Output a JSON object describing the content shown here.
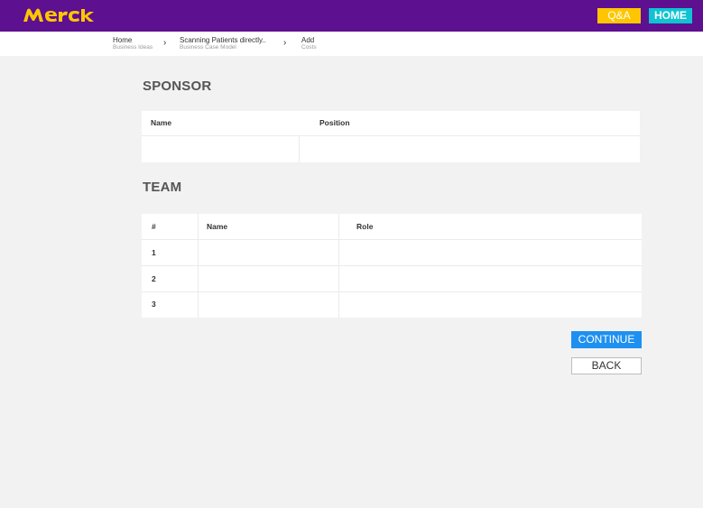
{
  "header": {
    "logo_text": "MERCK",
    "qa_label": "Q&A",
    "home_label": "HOME",
    "colors": {
      "bar": "#5d1090",
      "logo": "#ffc600",
      "qa": "#ffc600",
      "home": "#0fc3d3"
    }
  },
  "breadcrumb": [
    {
      "label": "Home",
      "sub": "Business Ideas"
    },
    {
      "label": "Scanning Patients directly..",
      "sub": "Business Case Model"
    },
    {
      "label": "Add",
      "sub": "Costs"
    }
  ],
  "sponsor": {
    "title": "SPONSOR",
    "columns": [
      "Name",
      "Position"
    ]
  },
  "team": {
    "title": "TEAM",
    "columns": [
      "#",
      "Name",
      "Role"
    ],
    "rows": [
      "1",
      "2",
      "3"
    ]
  },
  "actions": {
    "continue_label": "CONTINUE",
    "back_label": "BACK",
    "continue_color": "#1e90f0"
  }
}
